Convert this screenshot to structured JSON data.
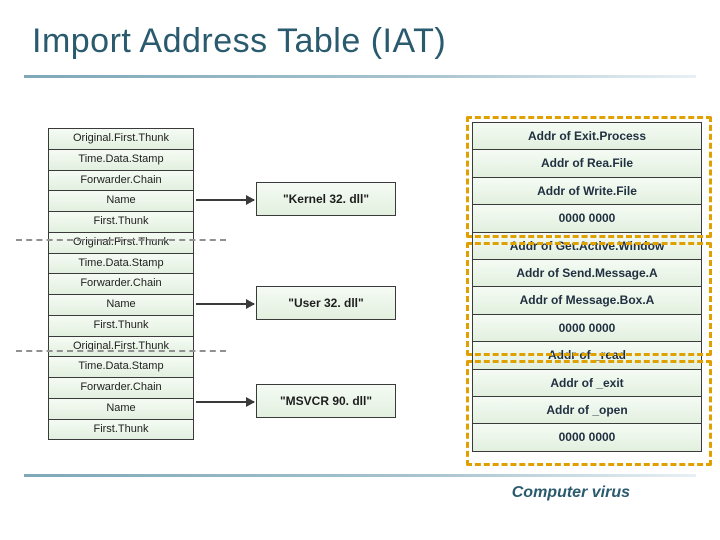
{
  "title": "Import Address Table (IAT)",
  "left_rows": [
    "Original.First.Thunk",
    "Time.Data.Stamp",
    "Forwarder.Chain",
    "Name",
    "First.Thunk",
    "Original.First.Thunk",
    "Time.Data.Stamp",
    "Forwarder.Chain",
    "Name",
    "First.Thunk",
    "Original.First.Thunk",
    "Time.Data.Stamp",
    "Forwarder.Chain",
    "Name",
    "First.Thunk"
  ],
  "mid": {
    "kernel": "\"Kernel 32. dll\"",
    "user": "\"User 32. dll\"",
    "msvcr": "\"MSVCR 90. dll\""
  },
  "right_rows": [
    "Addr of Exit.Process",
    "Addr of Rea.File",
    "Addr of Write.File",
    "0000 0000",
    "Addr of Get.Active.Window",
    "Addr of Send.Message.A",
    "Addr of Message.Box.A",
    "0000 0000",
    "Addr of _read",
    "Addr of _exit",
    "Addr of _open",
    "0000 0000"
  ],
  "footer": "Computer virus"
}
